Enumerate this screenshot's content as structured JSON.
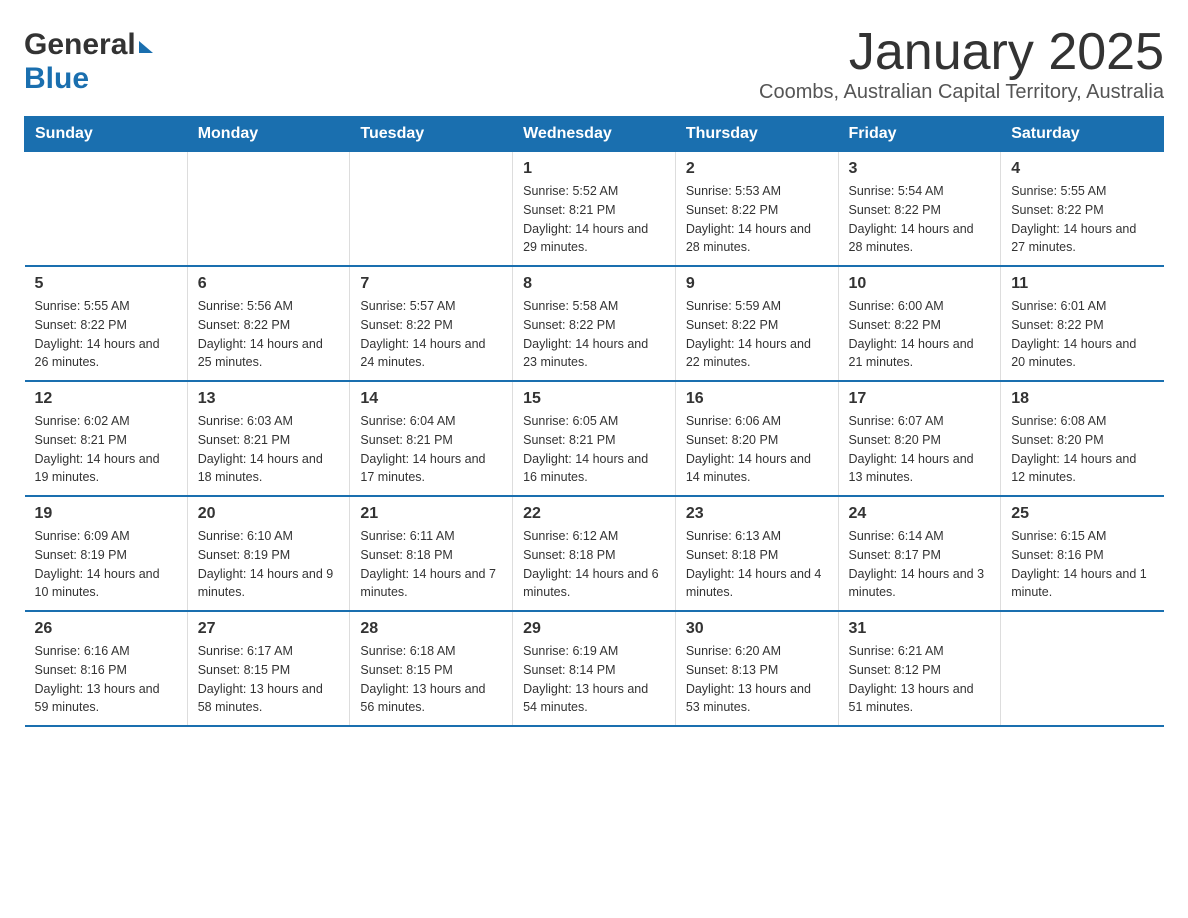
{
  "logo": {
    "general": "General",
    "blue": "Blue"
  },
  "title": "January 2025",
  "location": "Coombs, Australian Capital Territory, Australia",
  "days_of_week": [
    "Sunday",
    "Monday",
    "Tuesday",
    "Wednesday",
    "Thursday",
    "Friday",
    "Saturday"
  ],
  "weeks": [
    [
      {
        "day": "",
        "sunrise": "",
        "sunset": "",
        "daylight": ""
      },
      {
        "day": "",
        "sunrise": "",
        "sunset": "",
        "daylight": ""
      },
      {
        "day": "",
        "sunrise": "",
        "sunset": "",
        "daylight": ""
      },
      {
        "day": "1",
        "sunrise": "Sunrise: 5:52 AM",
        "sunset": "Sunset: 8:21 PM",
        "daylight": "Daylight: 14 hours and 29 minutes."
      },
      {
        "day": "2",
        "sunrise": "Sunrise: 5:53 AM",
        "sunset": "Sunset: 8:22 PM",
        "daylight": "Daylight: 14 hours and 28 minutes."
      },
      {
        "day": "3",
        "sunrise": "Sunrise: 5:54 AM",
        "sunset": "Sunset: 8:22 PM",
        "daylight": "Daylight: 14 hours and 28 minutes."
      },
      {
        "day": "4",
        "sunrise": "Sunrise: 5:55 AM",
        "sunset": "Sunset: 8:22 PM",
        "daylight": "Daylight: 14 hours and 27 minutes."
      }
    ],
    [
      {
        "day": "5",
        "sunrise": "Sunrise: 5:55 AM",
        "sunset": "Sunset: 8:22 PM",
        "daylight": "Daylight: 14 hours and 26 minutes."
      },
      {
        "day": "6",
        "sunrise": "Sunrise: 5:56 AM",
        "sunset": "Sunset: 8:22 PM",
        "daylight": "Daylight: 14 hours and 25 minutes."
      },
      {
        "day": "7",
        "sunrise": "Sunrise: 5:57 AM",
        "sunset": "Sunset: 8:22 PM",
        "daylight": "Daylight: 14 hours and 24 minutes."
      },
      {
        "day": "8",
        "sunrise": "Sunrise: 5:58 AM",
        "sunset": "Sunset: 8:22 PM",
        "daylight": "Daylight: 14 hours and 23 minutes."
      },
      {
        "day": "9",
        "sunrise": "Sunrise: 5:59 AM",
        "sunset": "Sunset: 8:22 PM",
        "daylight": "Daylight: 14 hours and 22 minutes."
      },
      {
        "day": "10",
        "sunrise": "Sunrise: 6:00 AM",
        "sunset": "Sunset: 8:22 PM",
        "daylight": "Daylight: 14 hours and 21 minutes."
      },
      {
        "day": "11",
        "sunrise": "Sunrise: 6:01 AM",
        "sunset": "Sunset: 8:22 PM",
        "daylight": "Daylight: 14 hours and 20 minutes."
      }
    ],
    [
      {
        "day": "12",
        "sunrise": "Sunrise: 6:02 AM",
        "sunset": "Sunset: 8:21 PM",
        "daylight": "Daylight: 14 hours and 19 minutes."
      },
      {
        "day": "13",
        "sunrise": "Sunrise: 6:03 AM",
        "sunset": "Sunset: 8:21 PM",
        "daylight": "Daylight: 14 hours and 18 minutes."
      },
      {
        "day": "14",
        "sunrise": "Sunrise: 6:04 AM",
        "sunset": "Sunset: 8:21 PM",
        "daylight": "Daylight: 14 hours and 17 minutes."
      },
      {
        "day": "15",
        "sunrise": "Sunrise: 6:05 AM",
        "sunset": "Sunset: 8:21 PM",
        "daylight": "Daylight: 14 hours and 16 minutes."
      },
      {
        "day": "16",
        "sunrise": "Sunrise: 6:06 AM",
        "sunset": "Sunset: 8:20 PM",
        "daylight": "Daylight: 14 hours and 14 minutes."
      },
      {
        "day": "17",
        "sunrise": "Sunrise: 6:07 AM",
        "sunset": "Sunset: 8:20 PM",
        "daylight": "Daylight: 14 hours and 13 minutes."
      },
      {
        "day": "18",
        "sunrise": "Sunrise: 6:08 AM",
        "sunset": "Sunset: 8:20 PM",
        "daylight": "Daylight: 14 hours and 12 minutes."
      }
    ],
    [
      {
        "day": "19",
        "sunrise": "Sunrise: 6:09 AM",
        "sunset": "Sunset: 8:19 PM",
        "daylight": "Daylight: 14 hours and 10 minutes."
      },
      {
        "day": "20",
        "sunrise": "Sunrise: 6:10 AM",
        "sunset": "Sunset: 8:19 PM",
        "daylight": "Daylight: 14 hours and 9 minutes."
      },
      {
        "day": "21",
        "sunrise": "Sunrise: 6:11 AM",
        "sunset": "Sunset: 8:18 PM",
        "daylight": "Daylight: 14 hours and 7 minutes."
      },
      {
        "day": "22",
        "sunrise": "Sunrise: 6:12 AM",
        "sunset": "Sunset: 8:18 PM",
        "daylight": "Daylight: 14 hours and 6 minutes."
      },
      {
        "day": "23",
        "sunrise": "Sunrise: 6:13 AM",
        "sunset": "Sunset: 8:18 PM",
        "daylight": "Daylight: 14 hours and 4 minutes."
      },
      {
        "day": "24",
        "sunrise": "Sunrise: 6:14 AM",
        "sunset": "Sunset: 8:17 PM",
        "daylight": "Daylight: 14 hours and 3 minutes."
      },
      {
        "day": "25",
        "sunrise": "Sunrise: 6:15 AM",
        "sunset": "Sunset: 8:16 PM",
        "daylight": "Daylight: 14 hours and 1 minute."
      }
    ],
    [
      {
        "day": "26",
        "sunrise": "Sunrise: 6:16 AM",
        "sunset": "Sunset: 8:16 PM",
        "daylight": "Daylight: 13 hours and 59 minutes."
      },
      {
        "day": "27",
        "sunrise": "Sunrise: 6:17 AM",
        "sunset": "Sunset: 8:15 PM",
        "daylight": "Daylight: 13 hours and 58 minutes."
      },
      {
        "day": "28",
        "sunrise": "Sunrise: 6:18 AM",
        "sunset": "Sunset: 8:15 PM",
        "daylight": "Daylight: 13 hours and 56 minutes."
      },
      {
        "day": "29",
        "sunrise": "Sunrise: 6:19 AM",
        "sunset": "Sunset: 8:14 PM",
        "daylight": "Daylight: 13 hours and 54 minutes."
      },
      {
        "day": "30",
        "sunrise": "Sunrise: 6:20 AM",
        "sunset": "Sunset: 8:13 PM",
        "daylight": "Daylight: 13 hours and 53 minutes."
      },
      {
        "day": "31",
        "sunrise": "Sunrise: 6:21 AM",
        "sunset": "Sunset: 8:12 PM",
        "daylight": "Daylight: 13 hours and 51 minutes."
      },
      {
        "day": "",
        "sunrise": "",
        "sunset": "",
        "daylight": ""
      }
    ]
  ]
}
